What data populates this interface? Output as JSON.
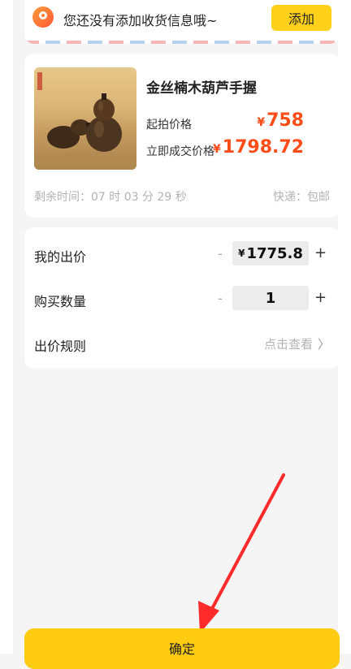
{
  "address": {
    "message": "您还没有添加收货信息哦~",
    "add_button": "添加",
    "icon": "location-pin-icon"
  },
  "product": {
    "title": "金丝楠木葫芦手握",
    "start_price_label": "起拍价格",
    "start_price_symbol": "¥",
    "start_price_value": "758",
    "buy_now_label": "立即成交价格",
    "buy_now_symbol": "¥",
    "buy_now_value": "1798.72",
    "remaining_time": "剩余时间：07 时 03 分 29 秒",
    "shipping": "快递：包邮"
  },
  "bid": {
    "my_bid_label": "我的出价",
    "my_bid_symbol": "¥",
    "my_bid_value": "1775.8",
    "quantity_label": "购买数量",
    "quantity_value": "1",
    "minus": "-",
    "plus": "+",
    "rule_label": "出价规则",
    "rule_link": "点击查看",
    "chevron": "〉"
  },
  "confirm_label": "确定",
  "colors": {
    "accent": "#ffcc11",
    "price": "#ff4d1a",
    "annotation_arrow": "#ff2a2a"
  }
}
